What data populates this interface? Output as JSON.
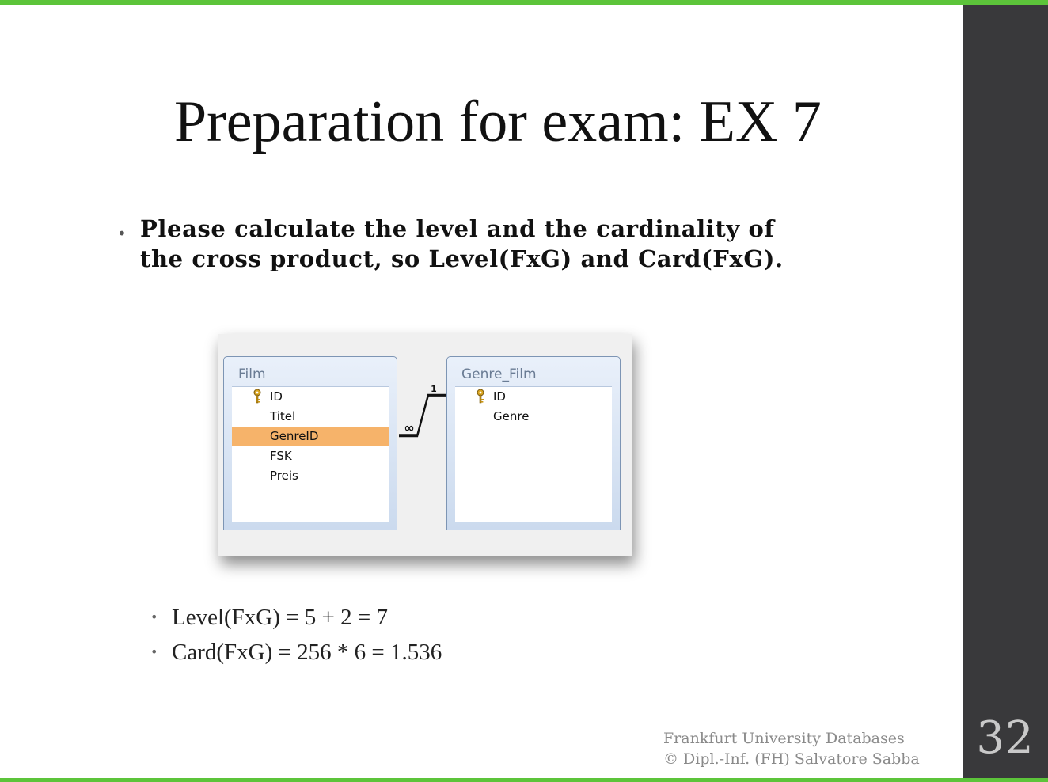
{
  "slide": {
    "title": "Preparation for exam: EX 7",
    "page_number": "32"
  },
  "task": {
    "line1": "Please calculate the level and the cardinality  of",
    "line2": "the cross product, so Level(FxG) and Card(FxG)."
  },
  "diagram": {
    "tables": [
      {
        "name": "Film",
        "fields": [
          {
            "label": "ID",
            "primary_key": true,
            "selected": false
          },
          {
            "label": "Titel",
            "primary_key": false,
            "selected": false
          },
          {
            "label": "GenreID",
            "primary_key": false,
            "selected": true
          },
          {
            "label": "FSK",
            "primary_key": false,
            "selected": false
          },
          {
            "label": "Preis",
            "primary_key": false,
            "selected": false
          }
        ]
      },
      {
        "name": "Genre_Film",
        "fields": [
          {
            "label": "ID",
            "primary_key": true,
            "selected": false
          },
          {
            "label": "Genre",
            "primary_key": false,
            "selected": false
          }
        ]
      }
    ],
    "relationship": {
      "one_side": "1",
      "many_side": "∞"
    },
    "colors": {
      "selected_field": "#f6b36a",
      "table_border": "#7d95b4"
    }
  },
  "results": [
    "Level(FxG) = 5 + 2 = 7",
    "Card(FxG) = 256 * 6 = 1.536"
  ],
  "footer": {
    "line1": "Frankfurt University Databases",
    "line2": "© Dipl.-Inf. (FH) Salvatore Sabba"
  },
  "colors": {
    "accent_green": "#5cc43a",
    "side_bar": "#39393b"
  }
}
